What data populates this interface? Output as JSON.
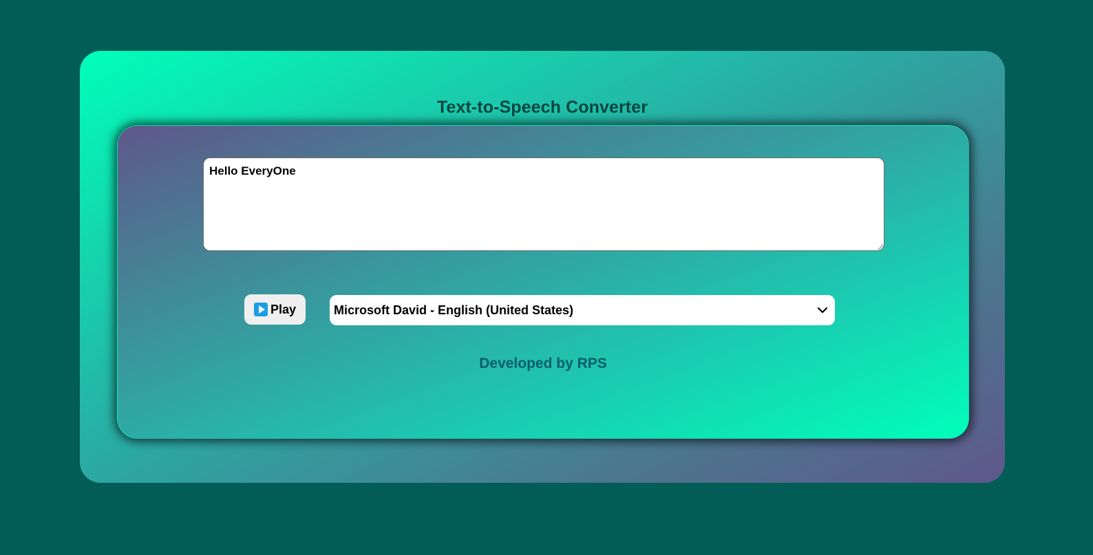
{
  "app": {
    "title": "Text-to-Speech Converter"
  },
  "editor": {
    "text": "Hello EveryOne"
  },
  "controls": {
    "play_label": "Play",
    "voice_selected": "Microsoft David - English (United States)"
  },
  "footer": {
    "credit": "Developed by RPS"
  },
  "colors": {
    "page_background": "#015d56",
    "gradient_mint": "#00ffb9",
    "gradient_purple": "#5f578a",
    "title_text": "#05473f",
    "footer_text": "#0b5e6b",
    "play_icon": "#1a9de2"
  },
  "icons": {
    "play": "play-icon",
    "dropdown": "chevron-down-icon",
    "resize": "resize-grip-icon"
  }
}
